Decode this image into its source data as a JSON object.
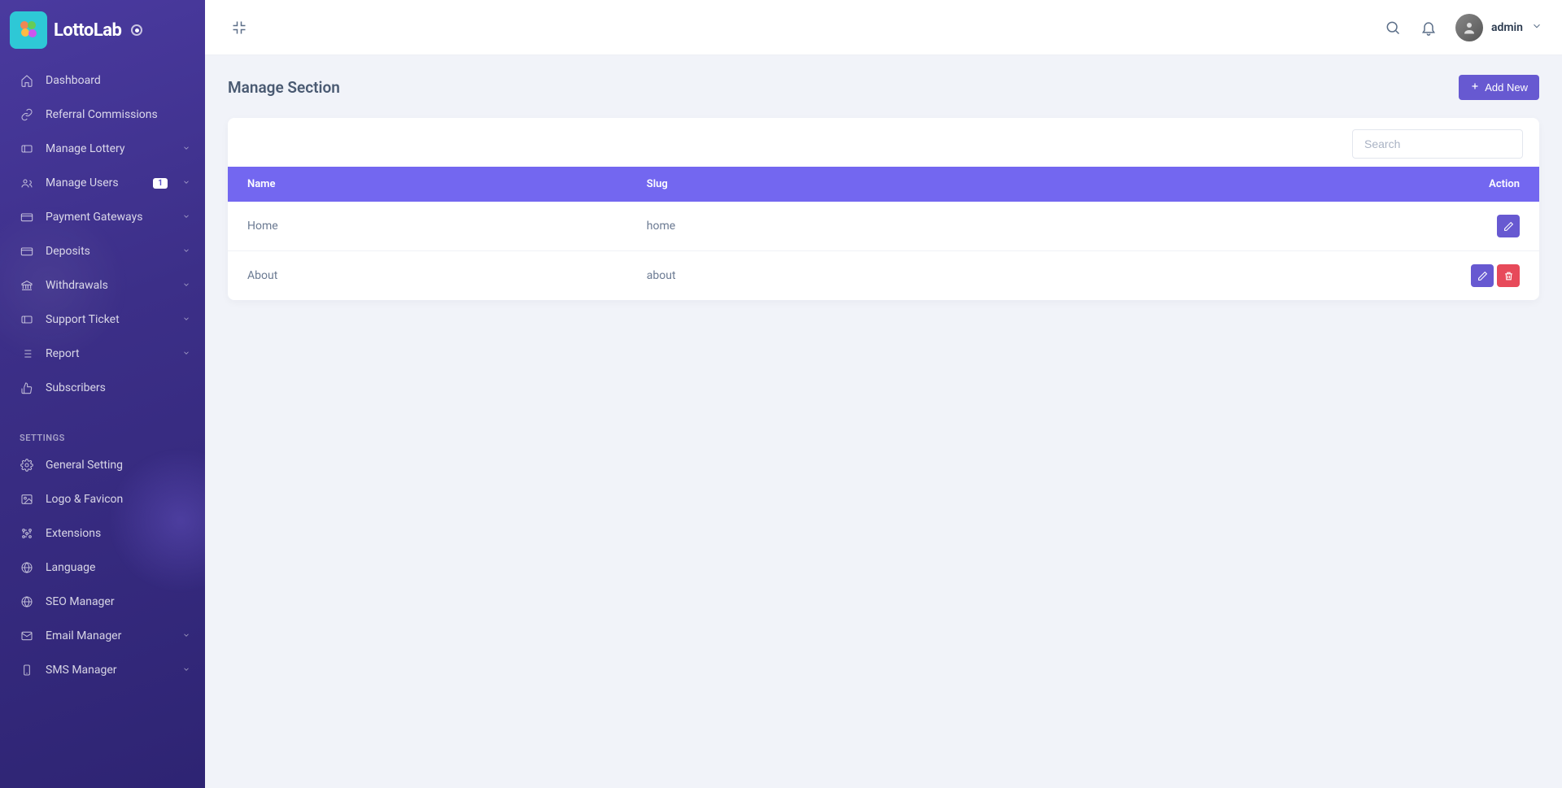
{
  "brand": {
    "name": "LottoLab"
  },
  "sidebar": {
    "items": [
      {
        "label": "Dashboard",
        "icon": "home",
        "hasChildren": false
      },
      {
        "label": "Referral Commissions",
        "icon": "link",
        "hasChildren": false
      },
      {
        "label": "Manage Lottery",
        "icon": "ticket",
        "hasChildren": true
      },
      {
        "label": "Manage Users",
        "icon": "users",
        "hasChildren": true,
        "badge": "1"
      },
      {
        "label": "Payment Gateways",
        "icon": "card",
        "hasChildren": true
      },
      {
        "label": "Deposits",
        "icon": "card",
        "hasChildren": true
      },
      {
        "label": "Withdrawals",
        "icon": "bank",
        "hasChildren": true
      },
      {
        "label": "Support Ticket",
        "icon": "ticket",
        "hasChildren": true
      },
      {
        "label": "Report",
        "icon": "list",
        "hasChildren": true
      },
      {
        "label": "Subscribers",
        "icon": "thumb",
        "hasChildren": false
      }
    ],
    "sectionLabel": "SETTINGS",
    "settings": [
      {
        "label": "General Setting",
        "icon": "gear",
        "hasChildren": false
      },
      {
        "label": "Logo & Favicon",
        "icon": "image",
        "hasChildren": false
      },
      {
        "label": "Extensions",
        "icon": "puzzle",
        "hasChildren": false
      },
      {
        "label": "Language",
        "icon": "globe",
        "hasChildren": false
      },
      {
        "label": "SEO Manager",
        "icon": "globe",
        "hasChildren": false
      },
      {
        "label": "Email Manager",
        "icon": "mail",
        "hasChildren": true
      },
      {
        "label": "SMS Manager",
        "icon": "phone",
        "hasChildren": true
      }
    ]
  },
  "header": {
    "userName": "admin"
  },
  "page": {
    "title": "Manage Section",
    "addButton": "Add New",
    "searchPlaceholder": "Search",
    "table": {
      "columns": {
        "name": "Name",
        "slug": "Slug",
        "action": "Action"
      },
      "rows": [
        {
          "name": "Home",
          "slug": "home",
          "canDelete": false
        },
        {
          "name": "About",
          "slug": "about",
          "canDelete": true
        }
      ]
    }
  }
}
